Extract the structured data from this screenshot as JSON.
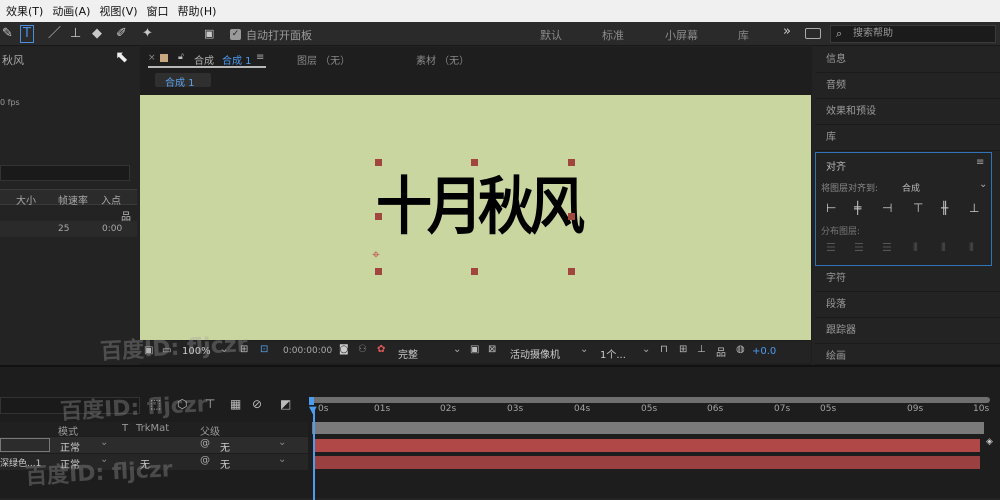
{
  "menu": [
    "效果(T)",
    "动画(A)",
    "视图(V)",
    "窗口",
    "帮助(H)"
  ],
  "toolbar": {
    "auto_open_label": "自动打开面板",
    "workspaces": [
      "默认",
      "标准",
      "小屏幕",
      "库"
    ],
    "more": "»",
    "search_placeholder": "搜索帮助"
  },
  "left": {
    "project_name": "秋风",
    "fps": "0 fps",
    "col_size": "大小",
    "col_rate": "帧速率",
    "col_in": "入点",
    "row_rate": "25",
    "row_in": "0:00"
  },
  "comp_panel": {
    "tab_comp_prefix": "合成",
    "tab_comp_name": "合成 1",
    "tab_layer": "图层 （无）",
    "tab_footage": "素材 （无）",
    "breadcrumb": "合成 1"
  },
  "viewer": {
    "text": "十月秋风",
    "bg": "#c9d6a0"
  },
  "viewer_bar": {
    "zoom": "100%",
    "timecode": "0:00:00:00",
    "quality": "完整",
    "camera": "活动摄像机",
    "views": "1个...",
    "offset": "+0.0"
  },
  "right_panel": {
    "items": [
      "信息",
      "音频",
      "效果和预设",
      "库"
    ],
    "align_title": "对齐",
    "align_to_label": "将图层对齐到:",
    "align_to_value": "合成",
    "distribute_label": "分布图层:",
    "items_after": [
      "字符",
      "段落",
      "跟踪器",
      "绘画"
    ]
  },
  "timeline": {
    "ruler": [
      "0s",
      "01s",
      "02s",
      "03s",
      "04s",
      "05s",
      "06s",
      "07s",
      "05s",
      "09s",
      "10s"
    ],
    "col_mode": "模式",
    "col_t": "T",
    "col_trkmat": "TrkMat",
    "col_parent": "父级",
    "layers": [
      {
        "name": "",
        "mode": "正常",
        "trkmat": "",
        "parent": "无"
      },
      {
        "name": "深绿色...1",
        "mode": "正常",
        "trkmat": "无",
        "parent": "无"
      }
    ]
  },
  "watermarks": [
    "百度ID: fljczr",
    "百度ID: fljczr",
    "百度ID: fljczr"
  ]
}
